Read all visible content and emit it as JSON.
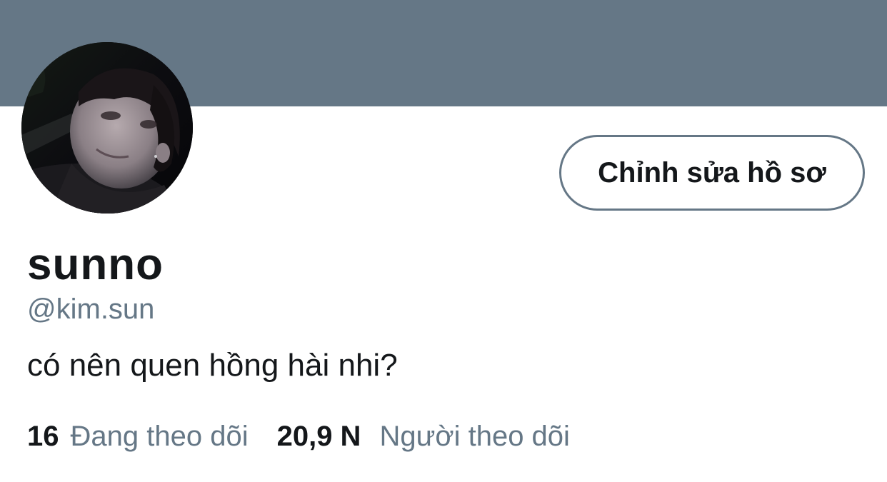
{
  "colors": {
    "banner": "#657786",
    "primary_text": "#14171a",
    "secondary_text": "#657786",
    "button_border": "#657786"
  },
  "profile": {
    "edit_button_label": "Chỉnh sửa hồ sơ",
    "display_name": "sunno",
    "handle": "@kim.sun",
    "bio": "có nên quen hồng hài nhi?"
  },
  "stats": {
    "following": {
      "count": "16",
      "label": "Đang theo dõi"
    },
    "followers": {
      "count": "20,9 N",
      "label": "Người theo dõi"
    }
  },
  "avatar": {
    "icon": "profile-photo"
  }
}
